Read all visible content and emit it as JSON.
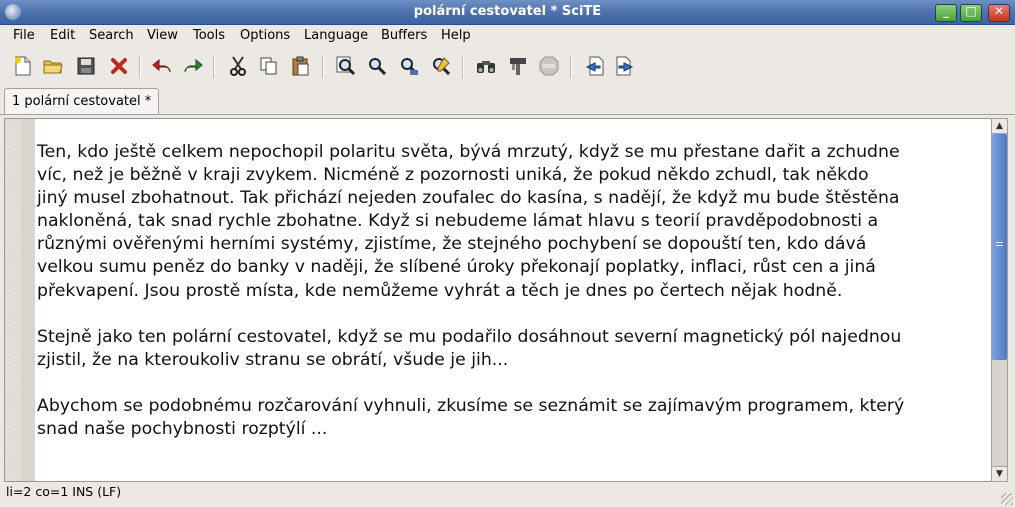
{
  "window": {
    "title": "polární cestovatel * SciTE",
    "buttons": {
      "minimize": "_",
      "maximize": "□",
      "close": "✕"
    }
  },
  "menu": [
    "File",
    "Edit",
    "Search",
    "View",
    "Tools",
    "Options",
    "Language",
    "Buffers",
    "Help"
  ],
  "toolbar": {
    "icons": [
      "new-file-icon",
      "open-folder-icon",
      "save-icon",
      "close-file-icon",
      "undo-icon",
      "redo-icon",
      "cut-icon",
      "copy-icon",
      "paste-icon",
      "find-icon",
      "find-next-icon",
      "find-in-files-icon",
      "replace-icon",
      "compile-icon",
      "build-icon",
      "stop-icon",
      "previous-buffer-icon",
      "next-buffer-icon"
    ]
  },
  "tabs": [
    {
      "label": "1 polární cestovatel *"
    }
  ],
  "editor": {
    "lines": [
      "Ten, kdo ještě celkem nepochopil polaritu světa, bývá mrzutý, když se mu přestane dařit a zchudne",
      "víc, než je běžně v kraji zvykem. Nicméně z pozornosti uniká, že pokud někdo zchudl, tak někdo",
      "jiný musel zbohatnout. Tak přichází nejeden zoufalec do kasína, s nadějí, že když mu bude štěstěna",
      "nakloněná, tak snad rychle zbohatne. Když si nebudeme lámat hlavu s teorií pravděpodobnosti a",
      "různými ověřenými herními systémy, zjistíme, že stejného pochybení se dopouští ten, kdo dává",
      "velkou sumu peněz do banky v naději, že slíbené úroky překonají poplatky, inflaci, růst cen a jiná",
      "překvapení. Jsou prostě místa, kde nemůžeme vyhrát a těch je dnes po čertech nějak hodně.",
      "",
      "Stejně jako ten polární cestovatel, když se mu podařilo dosáhnout severní magnetický pól najednou",
      "zjistil, že na kteroukoliv stranu se obrátí, všude je jih...",
      "",
      "Abychom se podobnému rozčarování vyhnuli, zkusíme se seznámit se zajímavým programem, který",
      "snad naše pochybnosti rozptýlí ..."
    ]
  },
  "status": {
    "text": "li=2 co=1 INS (LF)"
  },
  "colors": {
    "titlebar": "#4a70ad",
    "scroll_thumb": "#5a82c8",
    "undo": "#c0281e",
    "redo": "#2a8a2a"
  }
}
